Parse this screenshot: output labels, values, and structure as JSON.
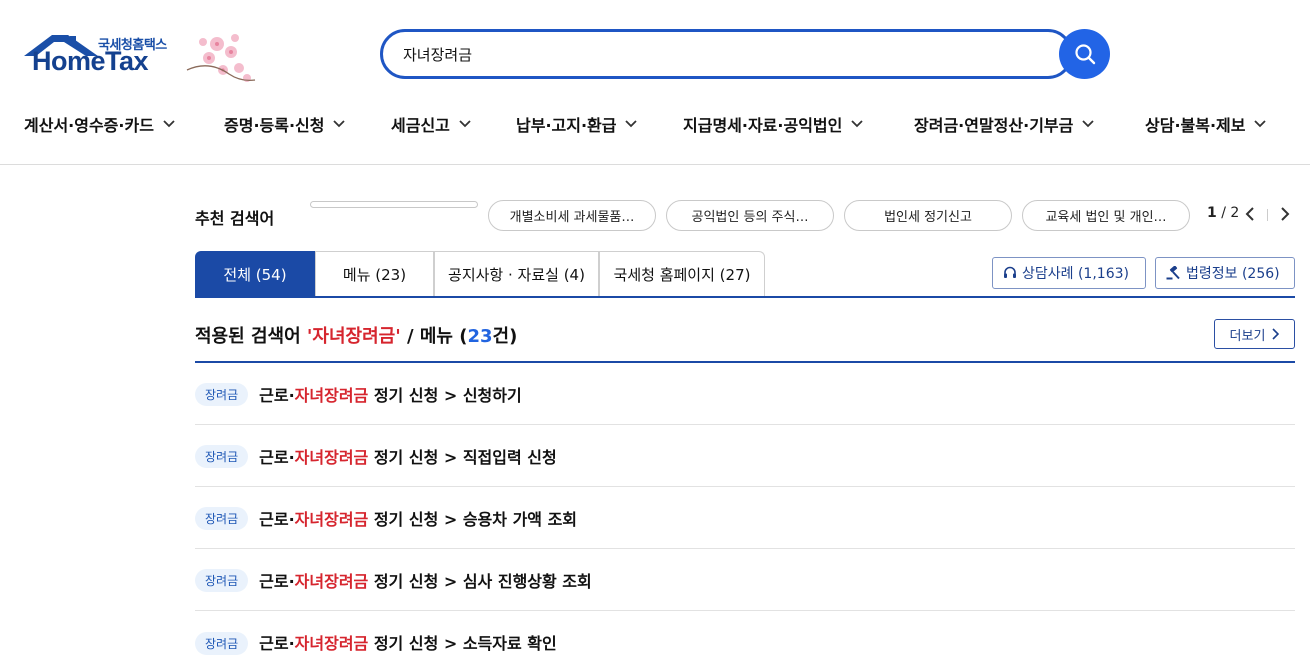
{
  "logo": {
    "small": "국세청홈택스",
    "main": "HomeTax"
  },
  "search": {
    "value": "자녀장려금"
  },
  "gnb": [
    "계산서·영수증·카드",
    "증명·등록·신청",
    "세금신고",
    "납부·고지·환급",
    "지급명세·자료·공익법인",
    "장려금·연말정산·기부금",
    "상담·불복·제보"
  ],
  "recommend": {
    "title": "추천 검색어",
    "chips": [
      "개별소비세 과세물품…",
      "공익법인 등의 주식…",
      "법인세 정기신고",
      "교육세 법인 및 개인…"
    ],
    "page_current": "1",
    "page_total": "/ 2"
  },
  "tabs": [
    "전체 (54)",
    "메뉴 (23)",
    "공지사항 · 자료실 (4)",
    "국세청 홈페이지 (27)"
  ],
  "side_buttons": {
    "consult": "상담사례 (1,163)",
    "law": "법령정보 (256)"
  },
  "applied": {
    "prefix": "적용된 검색어 ",
    "keyword": "'자녀장려금'",
    "middle": " / 메뉴 (",
    "count": "23",
    "suffix": "건)",
    "more": "더보기"
  },
  "results": [
    {
      "badge": "장려금",
      "pre": "근로·",
      "hl": "자녀장려금",
      "post": " 정기 신청 > 신청하기"
    },
    {
      "badge": "장려금",
      "pre": "근로·",
      "hl": "자녀장려금",
      "post": " 정기 신청 > 직접입력 신청"
    },
    {
      "badge": "장려금",
      "pre": "근로·",
      "hl": "자녀장려금",
      "post": " 정기 신청 > 승용차 가액 조회"
    },
    {
      "badge": "장려금",
      "pre": "근로·",
      "hl": "자녀장려금",
      "post": " 정기 신청 > 심사 진행상황 조회"
    },
    {
      "badge": "장려금",
      "pre": "근로·",
      "hl": "자녀장려금",
      "post": " 정기 신청 > 소득자료 확인"
    }
  ],
  "colors": {
    "brand": "#1b4aa6",
    "accent": "#2264e6",
    "highlight": "#d6252e"
  }
}
